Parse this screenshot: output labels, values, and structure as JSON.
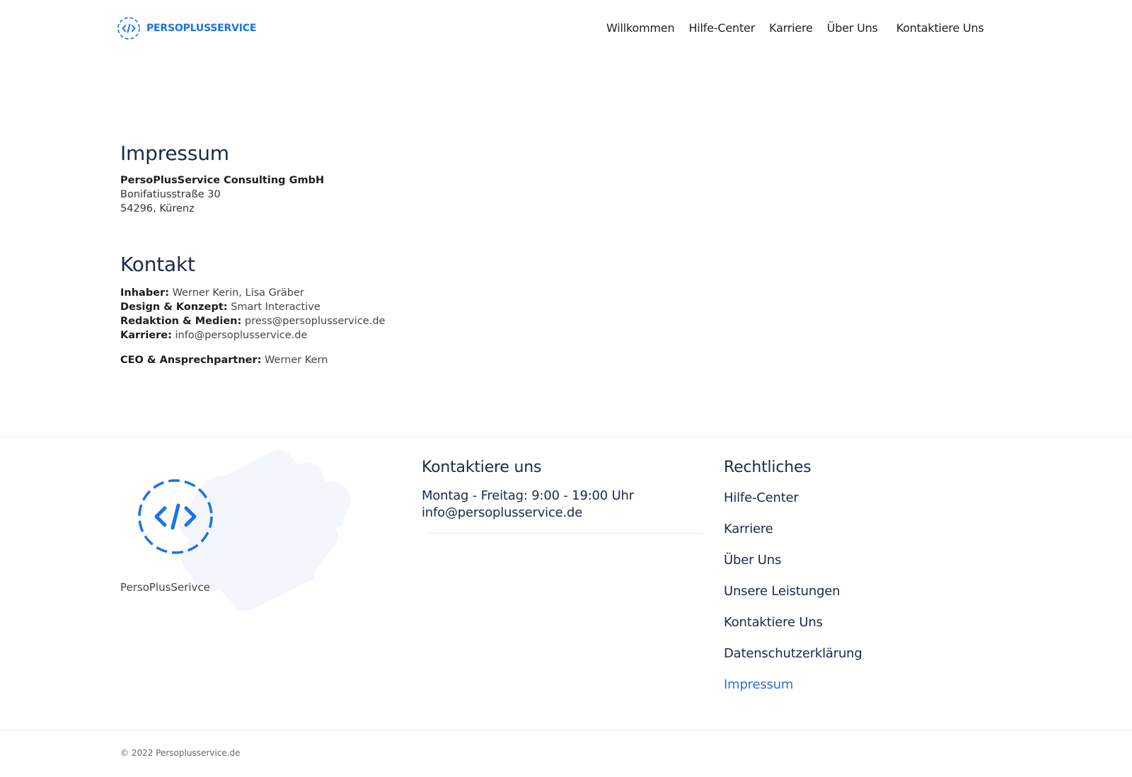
{
  "header": {
    "logo_text": "PERSOPLUSSERVICE",
    "nav": [
      {
        "label": "Willkommen"
      },
      {
        "label": "Hilfe-Center"
      },
      {
        "label": "Karriere"
      },
      {
        "label": "Über Uns"
      },
      {
        "label": "Kontaktiere Uns"
      }
    ]
  },
  "impressum": {
    "title": "Impressum",
    "company": "PersoPlusService Consulting GmbH",
    "street": "Bonifatiusstraße 30",
    "city": "54296, Kürenz"
  },
  "kontakt": {
    "title": "Kontakt",
    "items": [
      {
        "label": "Inhaber:",
        "value": "Werner Kerin, Lisa Gräber"
      },
      {
        "label": "Design & Konzept:",
        "value": "Smart Interactive"
      },
      {
        "label": "Redaktion & Medien:",
        "value": "press@persoplusservice.de"
      },
      {
        "label": "Karriere:",
        "value": "info@persoplusservice.de"
      }
    ],
    "ceo": {
      "label": "CEO & Ansprechpartner:",
      "value": "Werner Kern"
    }
  },
  "footer": {
    "brand": "PersoPlusSerivce",
    "contact": {
      "title": "Kontaktiere uns",
      "hours": "Montag - Freitag: 9:00 - 19:00 Uhr",
      "email": "info@persoplusservice.de"
    },
    "legal": {
      "title": "Rechtliches",
      "links": [
        {
          "label": "Hilfe-Center"
        },
        {
          "label": "Karriere"
        },
        {
          "label": "Über Uns"
        },
        {
          "label": "Unsere Leistungen"
        },
        {
          "label": "Kontaktiere Uns"
        },
        {
          "label": "Datenschutzerklärung"
        },
        {
          "label": "Impressum",
          "active": true
        }
      ]
    },
    "copyright": "© 2022 Persoplusservice.de"
  },
  "colors": {
    "brand": "#1a73e8",
    "heading": "#1b2a45",
    "active_link": "#2f6ee6",
    "blob": "#f3f7fd"
  },
  "icons": {
    "logo": "code-brackets-icon"
  }
}
